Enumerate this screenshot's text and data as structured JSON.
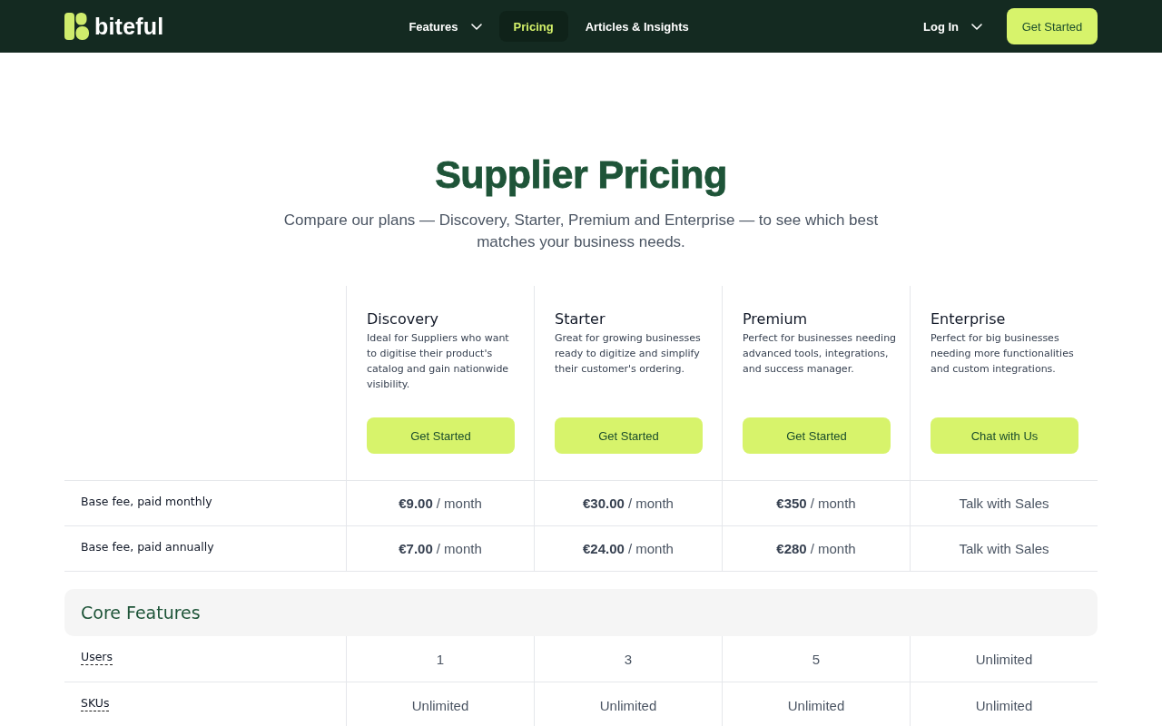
{
  "header": {
    "logo": "biteful",
    "nav": [
      {
        "label": "Features",
        "menu": true,
        "selected": false
      },
      {
        "label": "Pricing",
        "menu": false,
        "selected": true
      },
      {
        "label": "Articles & Insights",
        "menu": false,
        "selected": false
      }
    ],
    "login": {
      "label": "Log In",
      "menu": true
    },
    "cta": "Get Started"
  },
  "hero": {
    "title": "Supplier Pricing",
    "subtitle": "Compare our plans — Discovery, Starter, Premium and Enterprise — to see which best matches your business needs."
  },
  "plans": [
    {
      "name": "Discovery",
      "description": "Ideal for Suppliers who want to digitise their product's catalog and gain nationwide visibility.",
      "button": "Get Started"
    },
    {
      "name": "Starter",
      "description": "Great for growing businesses ready to digitize and simplify their customer's ordering.",
      "button": "Get Started"
    },
    {
      "name": "Premium",
      "description": "Perfect for businesses needing advanced tools, integrations, and success manager.",
      "button": "Get Started"
    },
    {
      "name": "Enterprise",
      "description": "Perfect for big businesses needing more functionalities and custom integrations.",
      "button": "Chat with Us"
    }
  ],
  "price_rows": [
    {
      "label": "Base fee, paid monthly",
      "has_tooltip": false,
      "cells": [
        "**€9.00** / month",
        "**€30.00** / month",
        "**€350** / month",
        "Talk with Sales"
      ]
    },
    {
      "label": "Base fee, paid annually",
      "has_tooltip": false,
      "cells": [
        "**€7.00** / month",
        "**€24.00** / month",
        "**€280** / month",
        "Talk with Sales"
      ]
    }
  ],
  "sections": [
    {
      "title": "Core Features",
      "rows": [
        {
          "label": "Users",
          "has_tooltip": true,
          "cells": [
            "1",
            "3",
            "5",
            "Unlimited"
          ]
        },
        {
          "label": "SKUs",
          "has_tooltip": true,
          "cells": [
            "Unlimited",
            "Unlimited",
            "Unlimited",
            "Unlimited"
          ]
        }
      ]
    }
  ]
}
